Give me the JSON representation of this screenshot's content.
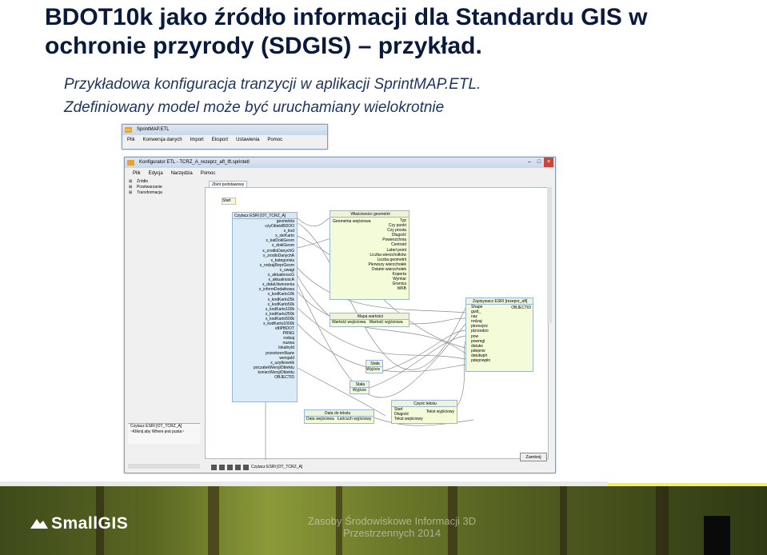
{
  "slide": {
    "title": "BDOT10k jako źródło informacji dla Standardu GIS w ochronie przyrody (SDGIS) – przykład.",
    "subtitle_line1": "Przykładowa konfiguracja tranzycji w aplikacji SprintMAP.ETL.",
    "subtitle_line2": "Zdefiniowany model może być uruchamiany wielokrotnie"
  },
  "app_window": {
    "title": "SprintMAP.ETL",
    "icon_label": "ETL",
    "menu": [
      "Plik",
      "Konwersja danych",
      "Import",
      "Eksport",
      "Ustawienia",
      "Pomoc"
    ]
  },
  "config_window": {
    "title": "Konfigurator ETL - TCRZ_A_rezeprz_aft_lft.sprintetl",
    "menu": [
      "Plik",
      "Edycja",
      "Narzędzia",
      "Pomoc"
    ],
    "tree": [
      "Źródło",
      "Przetwarzanie",
      "Transformacja"
    ],
    "tab": "Zbiór podstawowy",
    "start_label": "Start",
    "reader_block": {
      "title": "Czytacz ESRI [OT_TCRZ_A]",
      "fields": [
        "geometria",
        "czyObiektBDOO",
        "x_kod",
        "x_skrKarto",
        "x_katDoklGeom",
        "x_doklGeom",
        "x_zrodloDanychG",
        "x_zrodloDanychA",
        "x_kategorisia",
        "x_rodzajReprGeom",
        "x_uwagi",
        "x_aktualnoscG",
        "x_aktualnoscA",
        "x_dataUtworzenia",
        "x_informDodatkowa",
        "x_kodKarto10k",
        "x_kodKarto25k",
        "x_kodKarto50k",
        "x_kodKarto100k",
        "x_kodKarto250k",
        "x_kodKarto500k",
        "x_kodKarto1000k",
        "idIIPBDOT",
        "PRNG",
        "rodzaj",
        "nazwa",
        "lokalnyId",
        "przestrzenNazw",
        "wersjaId",
        "x_uzytkownik",
        "poczatekWersjiObiektu",
        "koniecWersjiObiektu",
        "OBJECTID"
      ]
    },
    "geom_block": {
      "title": "Właściwości geometrii",
      "header_left": "Geometria wejściowa",
      "fields": [
        "Typ",
        "Czy punkt",
        "Czy prosta",
        "Długość",
        "Powierzchnia",
        "Centroid",
        "Label point",
        "Liczba wierzchołków",
        "Liczba geometrii",
        "Pierwszy wierzchołek",
        "Ostatni wierzchołek",
        "Koperta",
        "Wymiar",
        "Granica",
        "WKB"
      ]
    },
    "map_block": {
      "title": "Mapa wartości",
      "row": "Wartość wejściowa   Wartość wyjściowa"
    },
    "const1": {
      "title": "Stała",
      "row": "Wyjście"
    },
    "const2": {
      "title": "Stała",
      "row": "Wyjście"
    },
    "date_block": {
      "title": "Data do tekstu",
      "row": "Data wejściowa   Łańcuch wyjściowy"
    },
    "part_block": {
      "title": "Część tekstu",
      "rows": [
        "Start",
        "Długość",
        "Tekst wejściowy"
      ],
      "right": "Tekst wyjściowy"
    },
    "writer_block": {
      "title": "Zapisywacz ESRI [rezeprz_aft]",
      "right": "OBJECTID",
      "fields": [
        "Shape",
        "guid_",
        "naz",
        "rodzaj",
        "ptorezprz",
        "ptzrzedzo",
        "pow",
        "powmgl",
        "datutw",
        "pdepnw",
        "datutwplr",
        "pdepnwpln"
      ]
    },
    "panel_bottom": [
      "Czytacz ESRI [OT_TCRZ_A]",
      "~Kliknij aby Where jest pusta~"
    ],
    "bottom_status": "Czytacz ESRI [OT_TCRZ_A]",
    "close_button": "Zamknij"
  },
  "footer": {
    "logo": "SmallGIS",
    "text": "Zasoby Środowiskowe Informacji 3D Przestrzennych 2014"
  },
  "colors": {
    "title": "#0a1a3c",
    "subtitle": "#1f3560",
    "accent_yellow": "#f2ec6f",
    "block_green": "#f3fbd9",
    "block_blue": "#dbecf8"
  }
}
